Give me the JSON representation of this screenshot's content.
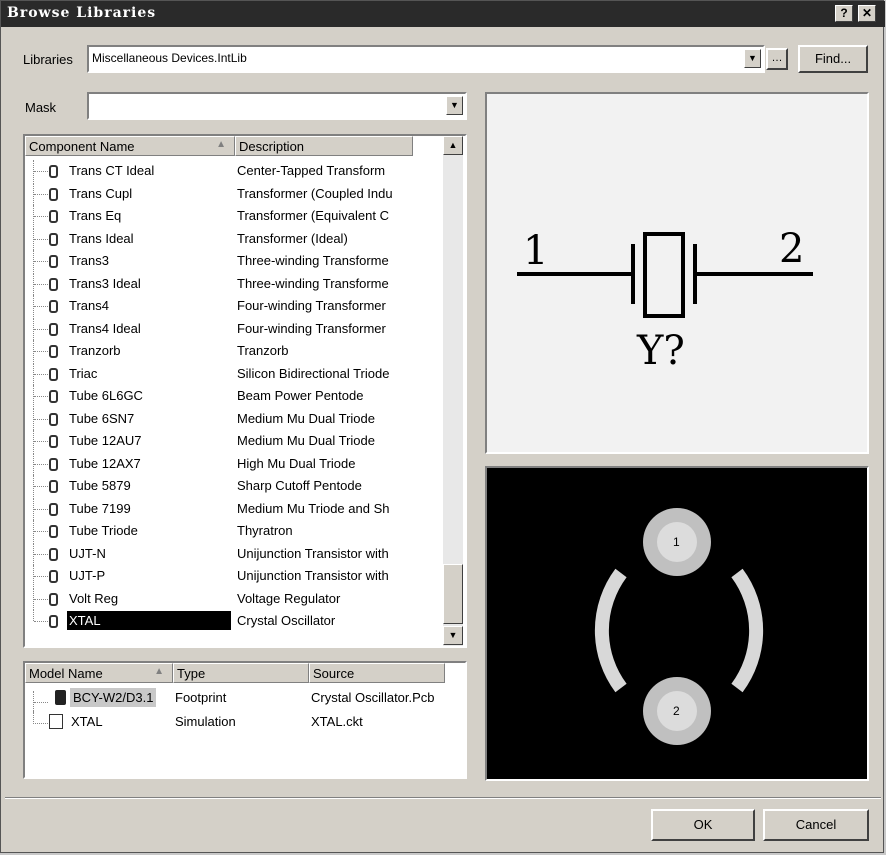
{
  "window": {
    "title": "Browse Libraries",
    "help_label": "?",
    "close_label": "✕"
  },
  "libraries": {
    "label": "Libraries",
    "value": "Miscellaneous Devices.IntLib",
    "find_label": "Find...",
    "browse_label": "…"
  },
  "mask": {
    "label": "Mask",
    "value": ""
  },
  "components": {
    "columns": [
      "Component Name",
      "Description"
    ],
    "rows": [
      {
        "name": "Trans CT Ideal",
        "desc": "Center-Tapped Transform"
      },
      {
        "name": "Trans Cupl",
        "desc": "Transformer (Coupled Indu"
      },
      {
        "name": "Trans Eq",
        "desc": "Transformer (Equivalent C"
      },
      {
        "name": "Trans Ideal",
        "desc": "Transformer (Ideal)"
      },
      {
        "name": "Trans3",
        "desc": "Three-winding Transforme"
      },
      {
        "name": "Trans3 Ideal",
        "desc": "Three-winding Transforme"
      },
      {
        "name": "Trans4",
        "desc": "Four-winding Transformer"
      },
      {
        "name": "Trans4 Ideal",
        "desc": "Four-winding Transformer"
      },
      {
        "name": "Tranzorb",
        "desc": "Tranzorb"
      },
      {
        "name": "Triac",
        "desc": "Silicon Bidirectional Triode"
      },
      {
        "name": "Tube 6L6GC",
        "desc": "Beam Power Pentode"
      },
      {
        "name": "Tube 6SN7",
        "desc": "Medium Mu Dual Triode"
      },
      {
        "name": "Tube 12AU7",
        "desc": "Medium Mu Dual Triode"
      },
      {
        "name": "Tube 12AX7",
        "desc": "High Mu Dual Triode"
      },
      {
        "name": "Tube 5879",
        "desc": "Sharp Cutoff Pentode"
      },
      {
        "name": "Tube 7199",
        "desc": "Medium Mu Triode and Sh"
      },
      {
        "name": "Tube Triode",
        "desc": "Thyratron"
      },
      {
        "name": "UJT-N",
        "desc": "Unijunction Transistor with"
      },
      {
        "name": "UJT-P",
        "desc": "Unijunction Transistor with"
      },
      {
        "name": "Volt Reg",
        "desc": "Voltage Regulator"
      },
      {
        "name": "XTAL",
        "desc": "Crystal Oscillator"
      }
    ]
  },
  "models": {
    "columns": [
      "Model Name",
      "Type",
      "Source"
    ],
    "rows": [
      {
        "name": "BCY-W2/D3.1",
        "type": "Footprint",
        "source": "Crystal Oscillator.Pcb"
      },
      {
        "name": "XTAL",
        "type": "Simulation",
        "source": "XTAL.ckt"
      }
    ]
  },
  "schematic": {
    "pin1": "1",
    "pin2": "2",
    "designator": "Y?"
  },
  "footprint": {
    "pad1": "1",
    "pad2": "2"
  },
  "buttons": {
    "ok": "OK",
    "cancel": "Cancel"
  },
  "glyphs": {
    "sort": "▲",
    "dropdown": "▼",
    "scroll_up": "▲",
    "scroll_down": "▼"
  }
}
